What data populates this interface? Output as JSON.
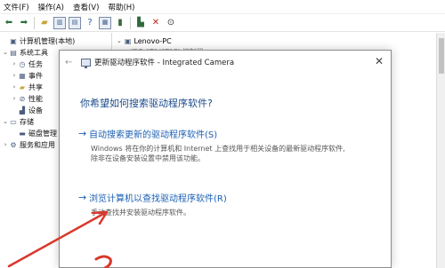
{
  "menu": [
    "文件(F)",
    "操作(A)",
    "查看(V)",
    "帮助(H)"
  ],
  "toolbar": {
    "icons": [
      "back-arrow-icon",
      "forward-arrow-icon",
      "up-folder-icon",
      "show-hide-tree-icon",
      "properties-icon",
      "help-icon",
      "refresh-icon",
      "scan-hardware-icon",
      "remove-x-icon",
      "download-icon"
    ]
  },
  "tree": {
    "root": "计算机管理(本地)",
    "system_tools": "系统工具",
    "items": [
      "任务",
      "事件",
      "共享",
      "性能",
      "设备"
    ],
    "storage": "存储",
    "disk": "磁盘管理",
    "services": "服务和应用"
  },
  "devices": {
    "computer": "Lenovo-PC",
    "partial": "IDE ATA/ATAPI 控制器"
  },
  "dialog": {
    "title": "更新驱动程序软件 - Integrated Camera",
    "question": "你希望如何搜索驱动程序软件?",
    "option1": {
      "label": "自动搜索更新的驱动程序软件(S)",
      "desc_line1": "Windows 将在你的计算机和 Internet 上查找用于相关设备的最新驱动程序软件,",
      "desc_line2": "除非在设备安装设置中禁用该功能。"
    },
    "option2": {
      "label": "浏览计算机以查找驱动程序软件(R)",
      "desc": "手动查找并安装驱动程序软件。"
    }
  },
  "colors": {
    "link_blue": "#1b5fb2",
    "question_blue": "#1b4a8a",
    "annotation_red": "#d9382c"
  }
}
